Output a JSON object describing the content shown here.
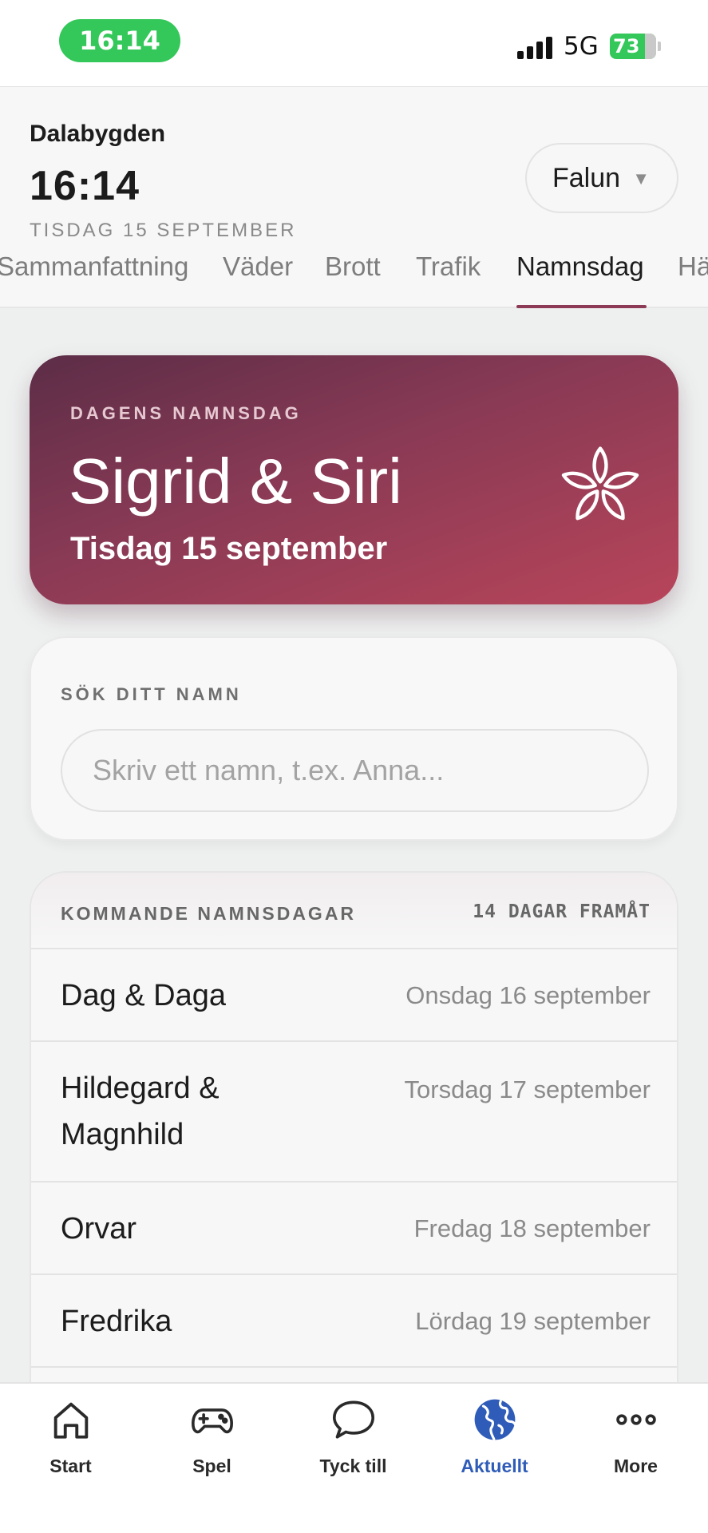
{
  "status_bar": {
    "time": "16:14",
    "network": "5G",
    "battery": "73",
    "battery_color": "#34c759"
  },
  "header": {
    "app_name": "Dalabygden",
    "clock": "16:14",
    "date": "TISDAG 15 SEPTEMBER",
    "city": "Falun",
    "city_caret": "▼"
  },
  "tabs": [
    {
      "label": "Sammanfattning",
      "active": false
    },
    {
      "label": "Väder",
      "active": false
    },
    {
      "label": "Brott",
      "active": false
    },
    {
      "label": "Trafik",
      "active": false
    },
    {
      "label": "Namnsdag",
      "active": true
    },
    {
      "label": "Hä",
      "active": false
    }
  ],
  "hero": {
    "kicker": "DAGENS NAMNSDAG",
    "names": "Sigrid & Siri",
    "date": "Tisdag 15 september",
    "icon": "flower-icon",
    "gradient": [
      "#5c2d47",
      "#8a3a55",
      "#b8455a"
    ]
  },
  "search": {
    "label": "SÖK DITT NAMN",
    "value": "",
    "placeholder": "Skriv ett namn, t.ex. Anna..."
  },
  "upcoming": {
    "title": "KOMMANDE NAMNSDAGAR",
    "range": "14 DAGAR FRAMÅT",
    "items": [
      {
        "name": "Dag & Daga",
        "date": "Onsdag 16 september"
      },
      {
        "name": "Hildegard & Magnhild",
        "date": "Torsdag 17 september"
      },
      {
        "name": "Orvar",
        "date": "Fredag 18 september"
      },
      {
        "name": "Fredrika",
        "date": "Lördag 19 september"
      }
    ]
  },
  "bottom_nav": [
    {
      "label": "Start",
      "icon": "home-icon",
      "active": false
    },
    {
      "label": "Spel",
      "icon": "gamepad-icon",
      "active": false
    },
    {
      "label": "Tyck till",
      "icon": "chat-bubble-icon",
      "active": false
    },
    {
      "label": "Aktuellt",
      "icon": "globe-icon",
      "active": true
    },
    {
      "label": "More",
      "icon": "more-dots-icon",
      "active": false
    }
  ],
  "accent_colors": {
    "tab_active": "#8c3a55",
    "nav_active": "#2f5cb8"
  }
}
